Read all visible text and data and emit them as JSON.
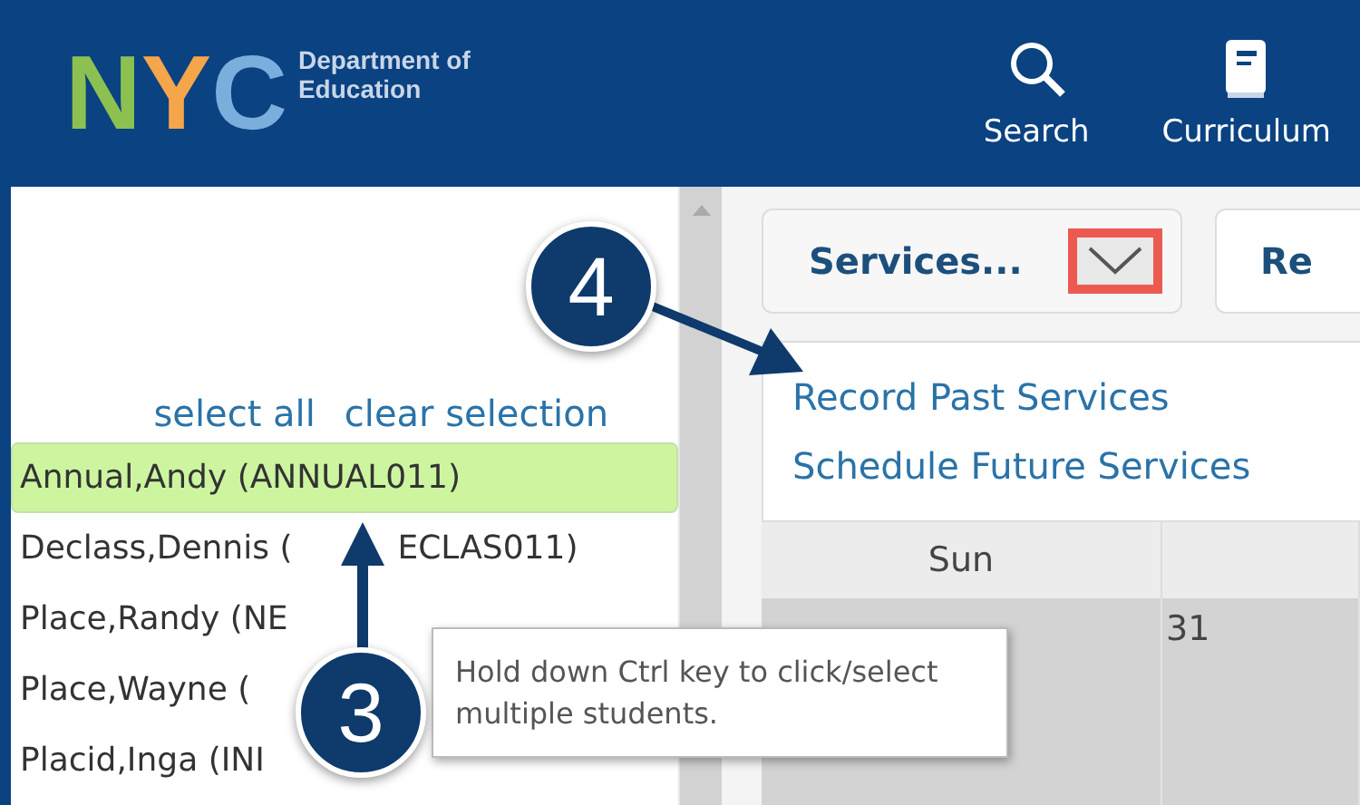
{
  "header": {
    "logo_letters": [
      {
        "text": "N",
        "color": "#8cc152"
      },
      {
        "text": "Y",
        "color": "#f5a54a"
      },
      {
        "text": "C",
        "color": "#7aaedc"
      }
    ],
    "org_lines": [
      "Department of",
      "Education"
    ],
    "nav": [
      {
        "label": "Search",
        "kind": "search"
      },
      {
        "label": "Curriculum",
        "kind": "book"
      }
    ]
  },
  "student_panel": {
    "links": [
      "select all",
      "clear selection"
    ],
    "students": [
      {
        "name_parts": [
          "Annual,Andy (ANNUAL011)"
        ],
        "selected": true
      },
      {
        "name_parts": [
          "Declass,Dennis (",
          "ECLAS011)"
        ],
        "selected": false
      },
      {
        "name_parts": [
          "Place,Randy (NE"
        ],
        "selected": false
      },
      {
        "name_parts": [
          "Place,Wayne ("
        ],
        "selected": false
      },
      {
        "name_parts": [
          "Placid,Inga (INI"
        ],
        "selected": false
      }
    ]
  },
  "services": {
    "button": "Services...",
    "toggle_highlighted": true,
    "next_button": "Re",
    "menu": [
      "Record Past Services",
      "Schedule Future Services"
    ]
  },
  "calendar": {
    "columns": [
      {
        "header": "Sun"
      },
      {
        "date": "31"
      }
    ]
  },
  "callouts": [
    {
      "number": "4"
    },
    {
      "number": "3"
    }
  ],
  "tooltip": "Hold down Ctrl key to click/select multiple students."
}
